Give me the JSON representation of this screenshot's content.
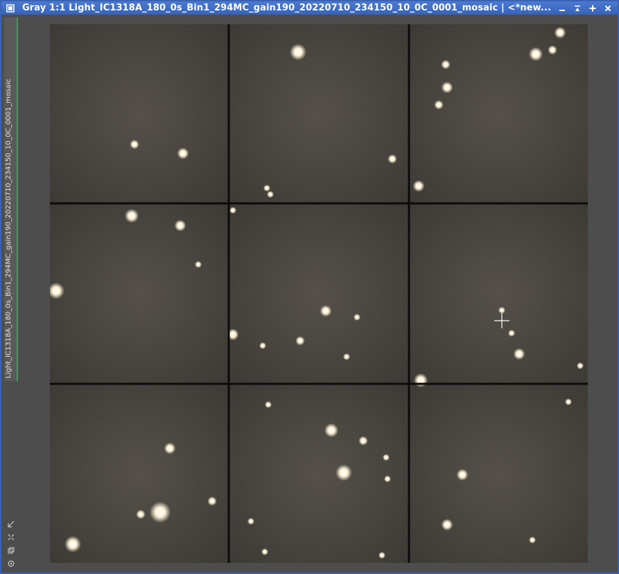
{
  "window": {
    "title": "Gray 1:1 Light_IC1318A_180_0s_Bin1_294MC_gain190_20220710_234150_10_0C_0001_mosaic | <*new...",
    "side_tab_label": "Light_IC1318A_180_0s_Bin1_294MC_gain190_20220710_234150_10_0C_0001_mosaic",
    "buttons": {
      "minimize": "minimize-icon",
      "shade": "shade-icon",
      "maximize": "maximize-icon",
      "close": "close-icon"
    }
  },
  "side_tools": [
    "fit-view-icon",
    "zoom-icon",
    "clone-icon",
    "settings-icon"
  ],
  "image": {
    "type": "mosaic",
    "grid": {
      "rows": 3,
      "cols": 3
    },
    "colors": {
      "background": "#2f2c28",
      "tile_center": "#4a463e",
      "separator": "#0b0b0b",
      "star": "#fff6e0",
      "cursor": "#ffffff"
    }
  }
}
